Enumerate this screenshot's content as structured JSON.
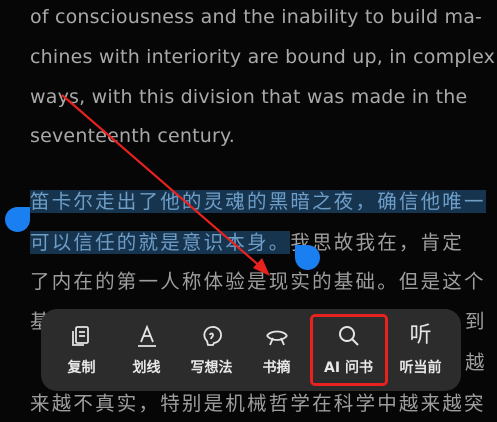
{
  "text_lines": [
    {
      "text": "of consciousness and the inability to build ma-"
    },
    {
      "text": "chines with interiority are bound up, in complex"
    },
    {
      "text": "ways, with this division that was made in the"
    },
    {
      "text": "seventeenth century."
    }
  ],
  "selected": {
    "line1": "笛卡尔走出了他的灵魂的黑暗之夜，确信他唯一",
    "line2": "可以信任的就是意识本身。"
  },
  "after_selected": "我思故我在，肯定",
  "zh_lines": [
    "了内在的第一人称体验是现实的基础。但是这个",
    "基",
    "来越不真实，特别是机械哲学在科学中越来越突"
  ],
  "zh_fragments": {
    "right_fragment_1": "到",
    "right_fragment_2": "越"
  },
  "toolbar": {
    "items": [
      {
        "label": "复制",
        "icon": "copy-icon"
      },
      {
        "label": "划线",
        "icon": "underline-icon"
      },
      {
        "label": "写想法",
        "icon": "thought-icon"
      },
      {
        "label": "书摘",
        "icon": "excerpt-icon"
      },
      {
        "label": "AI 问书",
        "icon": "search-icon"
      },
      {
        "label": "听当前",
        "icon": "listen-icon"
      }
    ]
  },
  "colors": {
    "selection_bg": "#17344f",
    "selection_text": "#6e9dc6",
    "handle": "#1a7ff0",
    "annotation": "#e8221e"
  }
}
